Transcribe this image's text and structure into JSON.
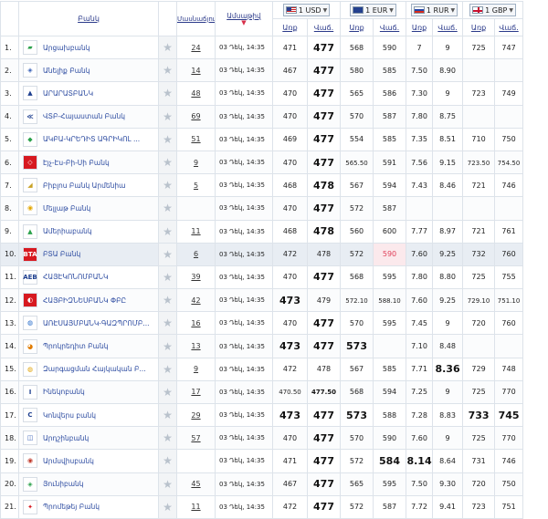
{
  "headers": {
    "bank": "Բանկ",
    "branches": "Մասնաճյուղեր",
    "date": "Ամսաթիվ",
    "buy": "Առք",
    "sell": "Վաճ."
  },
  "currencies": [
    {
      "label": "1 USD",
      "flag": "flag-us"
    },
    {
      "label": "1 EUR",
      "flag": "flag-eu"
    },
    {
      "label": "1 RUR",
      "flag": "flag-ru"
    },
    {
      "label": "1 GBP",
      "flag": "flag-gb"
    }
  ],
  "colors": {
    "accent": "#2b4aa0",
    "highlight_red": "#e0405a"
  },
  "rows": [
    {
      "n": "1.",
      "bank": "Արցախբանկ",
      "logo_bg": "#ffffff",
      "logo_fg": "#2aa14a",
      "logo_t": "▰",
      "branches": "24",
      "date": "03 Դեկ, 14:35",
      "usd_b": "471",
      "usd_s": "477",
      "eur_b": "568",
      "eur_s": "590",
      "rur_b": "7",
      "rur_s": "9",
      "gbp_b": "725",
      "gbp_s": "747"
    },
    {
      "n": "2.",
      "bank": "Անելիք Բանկ",
      "logo_bg": "#ffffff",
      "logo_fg": "#3b63b8",
      "logo_t": "◈",
      "branches": "14",
      "date": "03 Դեկ, 14:35",
      "usd_b": "467",
      "usd_s": "477",
      "eur_b": "580",
      "eur_s": "585",
      "rur_b": "7.50",
      "rur_s": "8.90",
      "gbp_b": "",
      "gbp_s": ""
    },
    {
      "n": "3.",
      "bank": "ԱՐԱՐԱՏԲԱՆԿ",
      "logo_bg": "#ffffff",
      "logo_fg": "#1e3f8f",
      "logo_t": "▲",
      "branches": "48",
      "date": "03 Դեկ, 14:35",
      "usd_b": "470",
      "usd_s": "477",
      "eur_b": "565",
      "eur_s": "586",
      "rur_b": "7.30",
      "rur_s": "9",
      "gbp_b": "723",
      "gbp_s": "749"
    },
    {
      "n": "4.",
      "bank": "ՎՏԲ-Հայաստան Բանկ",
      "logo_bg": "#ffffff",
      "logo_fg": "#1e3f8f",
      "logo_t": "≪",
      "branches": "69",
      "date": "03 Դեկ, 14:35",
      "usd_b": "470",
      "usd_s": "477",
      "eur_b": "570",
      "eur_s": "587",
      "rur_b": "7.80",
      "rur_s": "8.75",
      "gbp_b": "",
      "gbp_s": ""
    },
    {
      "n": "5.",
      "bank": "ԱԿԲԱ-ԿՐԵԴԻՏ ԱԳՐԻԿՈԼ ...",
      "logo_bg": "#ffffff",
      "logo_fg": "#2aa14a",
      "logo_t": "◆",
      "branches": "51",
      "date": "03 Դեկ, 14:35",
      "usd_b": "469",
      "usd_s": "477",
      "eur_b": "554",
      "eur_s": "585",
      "rur_b": "7.35",
      "rur_s": "8.51",
      "gbp_b": "710",
      "gbp_s": "750"
    },
    {
      "n": "6.",
      "bank": "Էյչ-Էս-Բի-Սի Բանկ",
      "logo_bg": "#d71920",
      "logo_fg": "#ffffff",
      "logo_t": "◇",
      "branches": "9",
      "date": "03 Դեկ, 14:35",
      "usd_b": "470",
      "usd_s": "477",
      "eur_b": "565.50",
      "eur_s": "591",
      "rur_b": "7.56",
      "rur_s": "9.15",
      "gbp_b": "723.50",
      "gbp_s": "754.50"
    },
    {
      "n": "7.",
      "bank": "Բիբլոս Բանկ Արմենիա",
      "logo_bg": "#ffffff",
      "logo_fg": "#c9a227",
      "logo_t": "◢",
      "branches": "5",
      "date": "03 Դեկ, 14:35",
      "usd_b": "468",
      "usd_s": "478",
      "eur_b": "567",
      "eur_s": "594",
      "rur_b": "7.43",
      "rur_s": "8.46",
      "gbp_b": "721",
      "gbp_s": "746"
    },
    {
      "n": "8.",
      "bank": "Մելլաթ Բանկ",
      "logo_bg": "#ffffff",
      "logo_fg": "#e3a700",
      "logo_t": "◉",
      "branches": "",
      "date": "03 Դեկ, 14:35",
      "usd_b": "470",
      "usd_s": "477",
      "eur_b": "572",
      "eur_s": "587",
      "rur_b": "",
      "rur_s": "",
      "gbp_b": "",
      "gbp_s": ""
    },
    {
      "n": "9.",
      "bank": "Ամերիաբանկ",
      "logo_bg": "#ffffff",
      "logo_fg": "#2aa14a",
      "logo_t": "▲",
      "branches": "11",
      "date": "03 Դեկ, 14:35",
      "usd_b": "468",
      "usd_s": "478",
      "eur_b": "560",
      "eur_s": "600",
      "rur_b": "7.77",
      "rur_s": "8.97",
      "gbp_b": "721",
      "gbp_s": "761"
    },
    {
      "n": "10.",
      "bank": "ԲՏԱ Բանկ",
      "logo_bg": "#d71920",
      "logo_fg": "#ffffff",
      "logo_t": "BTA",
      "branches": "6",
      "date": "03 Դեկ, 14:35",
      "usd_b": "472",
      "usd_s": "478",
      "eur_b": "572",
      "eur_s": "590",
      "rur_b": "7.60",
      "rur_s": "9.25",
      "gbp_b": "732",
      "gbp_s": "760"
    },
    {
      "n": "11.",
      "bank": "ՀԱՅԷԿՈՆՈՄԲԱՆԿ",
      "logo_bg": "#ffffff",
      "logo_fg": "#1e3f8f",
      "logo_t": "AEB",
      "branches": "39",
      "date": "03 Դեկ, 14:35",
      "usd_b": "470",
      "usd_s": "477",
      "eur_b": "568",
      "eur_s": "595",
      "rur_b": "7.80",
      "rur_s": "8.80",
      "gbp_b": "725",
      "gbp_s": "755"
    },
    {
      "n": "12.",
      "bank": "ՀԱՅԲԻԶՆԵՍԲԱՆԿ ՓԲԸ",
      "logo_bg": "#d71920",
      "logo_fg": "#ffffff",
      "logo_t": "◐",
      "branches": "42",
      "date": "03 Դեկ, 14:35",
      "usd_b": "473",
      "usd_s": "479",
      "eur_b": "572.10",
      "eur_s": "588.10",
      "rur_b": "7.60",
      "rur_s": "9.25",
      "gbp_b": "729.10",
      "gbp_s": "751.10"
    },
    {
      "n": "13.",
      "bank": "ԱՌԷՍԱՅՄԲԱՆԿ-ԳԱԶՊՐՈՄԲ...",
      "logo_bg": "#ffffff",
      "logo_fg": "#1e66c8",
      "logo_t": "◍",
      "branches": "16",
      "date": "03 Դեկ, 14:35",
      "usd_b": "470",
      "usd_s": "477",
      "eur_b": "570",
      "eur_s": "595",
      "rur_b": "7.45",
      "rur_s": "9",
      "gbp_b": "720",
      "gbp_s": "760"
    },
    {
      "n": "14.",
      "bank": "Պրոկրեդիտ Բանկ",
      "logo_bg": "#ffffff",
      "logo_fg": "#e07b00",
      "logo_t": "◕",
      "branches": "13",
      "date": "03 Դեկ, 14:35",
      "usd_b": "473",
      "usd_s": "477",
      "eur_b": "573",
      "eur_s": "",
      "rur_b": "7.10",
      "rur_s": "8.48",
      "gbp_b": "",
      "gbp_s": ""
    },
    {
      "n": "15.",
      "bank": "Զարգացման Հայկական Բ...",
      "logo_bg": "#ffffff",
      "logo_fg": "#e0a000",
      "logo_t": "◍",
      "branches": "9",
      "date": "03 Դեկ, 14:35",
      "usd_b": "472",
      "usd_s": "478",
      "eur_b": "567",
      "eur_s": "585",
      "rur_b": "7.71",
      "rur_s": "8.36",
      "gbp_b": "729",
      "gbp_s": "748"
    },
    {
      "n": "16.",
      "bank": "Ինեկոբանկ",
      "logo_bg": "#ffffff",
      "logo_fg": "#1e3f8f",
      "logo_t": "I",
      "branches": "17",
      "date": "03 Դեկ, 14:35",
      "usd_b": "470.50",
      "usd_s": "477.50",
      "eur_b": "568",
      "eur_s": "594",
      "rur_b": "7.25",
      "rur_s": "9",
      "gbp_b": "725",
      "gbp_s": "770"
    },
    {
      "n": "17.",
      "bank": "Կոնվերս բանկ",
      "logo_bg": "#ffffff",
      "logo_fg": "#1e3f8f",
      "logo_t": "C",
      "branches": "29",
      "date": "03 Դեկ, 14:35",
      "usd_b": "473",
      "usd_s": "477",
      "eur_b": "573",
      "eur_s": "588",
      "rur_b": "7.28",
      "rur_s": "8.83",
      "gbp_b": "733",
      "gbp_s": "745"
    },
    {
      "n": "18.",
      "bank": "Արդշինբանկ",
      "logo_bg": "#ffffff",
      "logo_fg": "#3b63b8",
      "logo_t": "◫",
      "branches": "57",
      "date": "03 Դեկ, 14:35",
      "usd_b": "470",
      "usd_s": "477",
      "eur_b": "570",
      "eur_s": "590",
      "rur_b": "7.60",
      "rur_s": "9",
      "gbp_b": "725",
      "gbp_s": "770"
    },
    {
      "n": "19.",
      "bank": "Արմսվիսբանկ",
      "logo_bg": "#ffffff",
      "logo_fg": "#c0392b",
      "logo_t": "◉",
      "branches": "",
      "date": "03 Դեկ, 14:35",
      "usd_b": "471",
      "usd_s": "477",
      "eur_b": "572",
      "eur_s": "584",
      "rur_b": "8.14",
      "rur_s": "8.64",
      "gbp_b": "731",
      "gbp_s": "746"
    },
    {
      "n": "20.",
      "bank": "Յունիբանկ",
      "logo_bg": "#ffffff",
      "logo_fg": "#2aa14a",
      "logo_t": "◈",
      "branches": "45",
      "date": "03 Դեկ, 14:35",
      "usd_b": "467",
      "usd_s": "477",
      "eur_b": "565",
      "eur_s": "595",
      "rur_b": "7.50",
      "rur_s": "9.30",
      "gbp_b": "720",
      "gbp_s": "750"
    },
    {
      "n": "21.",
      "bank": "Պրոմեթեյ Բանկ",
      "logo_bg": "#ffffff",
      "logo_fg": "#d71920",
      "logo_t": "✦",
      "branches": "11",
      "date": "03 Դեկ, 14:35",
      "usd_b": "472",
      "usd_s": "477",
      "eur_b": "572",
      "eur_s": "587",
      "rur_b": "7.72",
      "rur_s": "9.41",
      "gbp_b": "723",
      "gbp_s": "751"
    }
  ]
}
